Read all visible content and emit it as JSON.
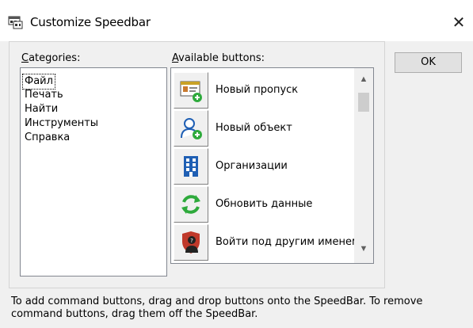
{
  "window": {
    "title": "Customize Speedbar",
    "close_glyph": "✕",
    "app_icon": "speedbar-icon"
  },
  "categories": {
    "label_prefix": "C",
    "label_rest": "ategories:",
    "items": [
      {
        "label": "Файл",
        "selected": true
      },
      {
        "label": "Печать",
        "selected": false
      },
      {
        "label": "Найти",
        "selected": false
      },
      {
        "label": "Инструменты",
        "selected": false
      },
      {
        "label": "Справка",
        "selected": false
      }
    ]
  },
  "available": {
    "label_prefix": "A",
    "label_rest": "vailable buttons:",
    "buttons": [
      {
        "label": "Новый пропуск",
        "icon": "new-pass-icon"
      },
      {
        "label": "Новый объект",
        "icon": "new-object-icon"
      },
      {
        "label": "Организации",
        "icon": "organizations-icon"
      },
      {
        "label": "Обновить данные",
        "icon": "refresh-icon"
      },
      {
        "label": "Войти под другим именем",
        "icon": "switch-user-icon"
      }
    ],
    "scroll_up": "▲",
    "scroll_down": "▼"
  },
  "ok_button": "OK",
  "info": "To add command buttons, drag and drop buttons onto the SpeedBar. To remove command buttons, drag them off the SpeedBar.",
  "colors": {
    "dialog_bg": "#f0f0f0",
    "accent_green": "#2eaa3c",
    "accent_blue": "#1f5fb4",
    "accent_red": "#c0392b"
  }
}
